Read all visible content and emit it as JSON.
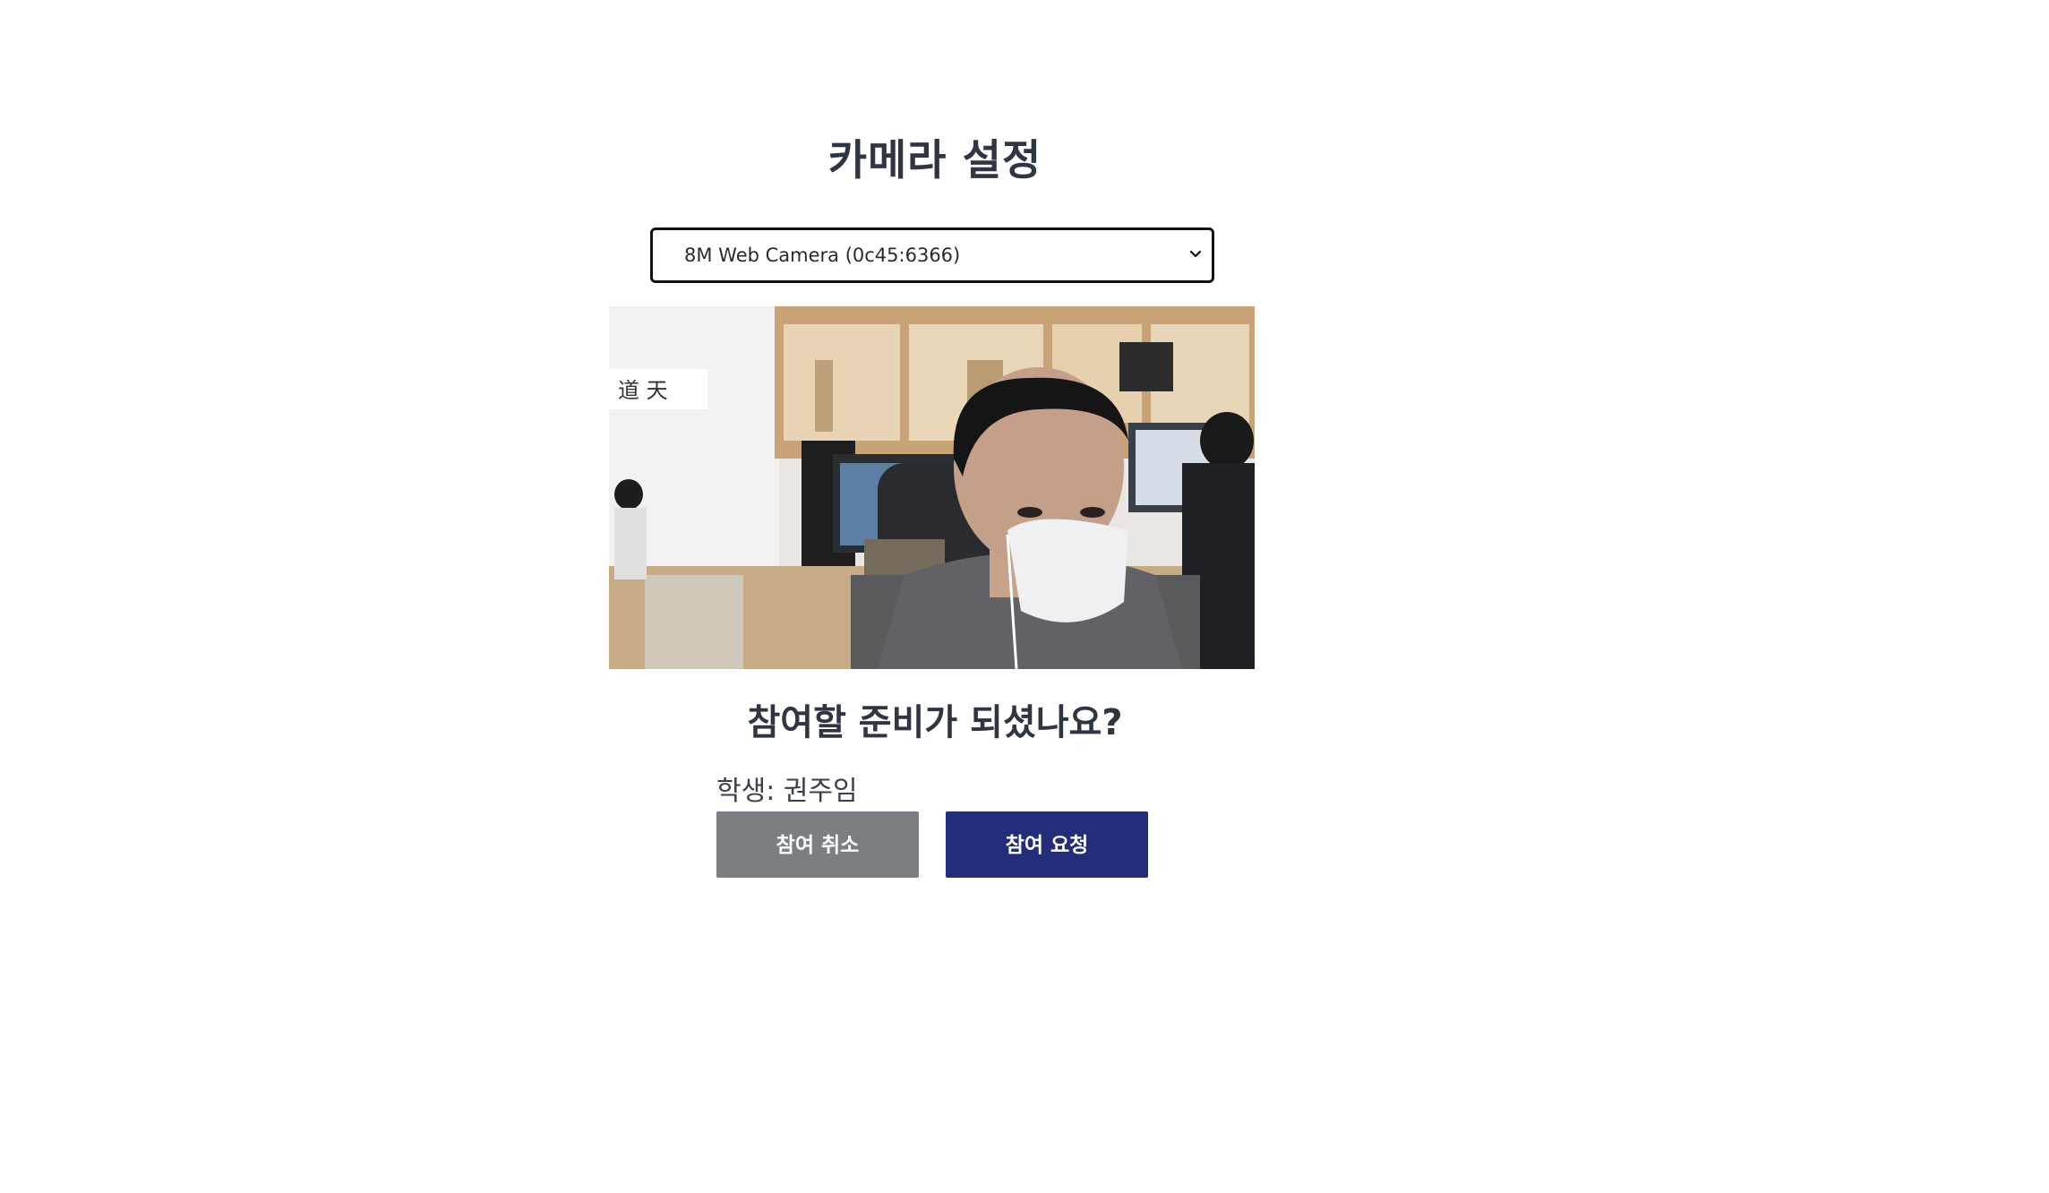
{
  "header": {
    "title": "카메라 설정"
  },
  "camera_select": {
    "selected": "8M Web Camera (0c45:6366)",
    "chevron_icon": "chevron-down-icon"
  },
  "video_preview": {
    "description_icon": "webcam-preview"
  },
  "prompt": {
    "question": "참여할 준비가 되셨나요?",
    "student_label": "학생: 권주임"
  },
  "actions": {
    "cancel_label": "참여 취소",
    "request_label": "참여 요청"
  },
  "colors": {
    "cancel_bg": "#7b7e83",
    "request_bg": "#232d7a",
    "text_dark": "#2f3542"
  }
}
